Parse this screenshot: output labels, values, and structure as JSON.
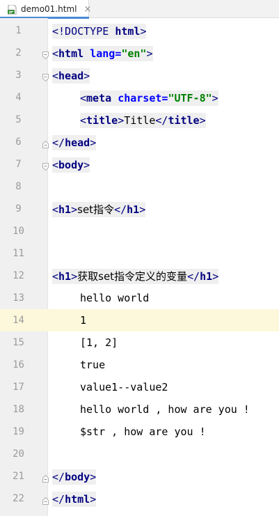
{
  "tab": {
    "filename": "demo01.html",
    "close": "×"
  },
  "current_line": 14,
  "lines": [
    {
      "n": "1",
      "i": 0
    },
    {
      "n": "2",
      "i": 0,
      "fold": true
    },
    {
      "n": "3",
      "i": 0,
      "fold": true
    },
    {
      "n": "4",
      "i": 1
    },
    {
      "n": "5",
      "i": 1
    },
    {
      "n": "6",
      "i": 0,
      "fold": true
    },
    {
      "n": "7",
      "i": 0,
      "fold": true
    },
    {
      "n": "8",
      "i": 0
    },
    {
      "n": "9",
      "i": 0
    },
    {
      "n": "10",
      "i": 0
    },
    {
      "n": "11",
      "i": 0
    },
    {
      "n": "12",
      "i": 0
    },
    {
      "n": "13",
      "i": 1
    },
    {
      "n": "14",
      "i": 1
    },
    {
      "n": "15",
      "i": 1
    },
    {
      "n": "16",
      "i": 1
    },
    {
      "n": "17",
      "i": 1
    },
    {
      "n": "18",
      "i": 1
    },
    {
      "n": "19",
      "i": 1
    },
    {
      "n": "20",
      "i": 0
    },
    {
      "n": "21",
      "i": 0,
      "fold": true
    },
    {
      "n": "22",
      "i": 0,
      "fold": true
    }
  ],
  "code": {
    "l1": {
      "lt": "<",
      "tag": "!DOCTYPE",
      "sp": " ",
      "kw": "html",
      "gt": ">"
    },
    "l2": {
      "lt": "<",
      "tag": "html",
      "sp": " ",
      "attr": "lang",
      "eq": "=",
      "val": "\"en\"",
      "gt": ">"
    },
    "l3": {
      "lt": "<",
      "tag": "head",
      "gt": ">"
    },
    "l4": {
      "lt": "<",
      "tag": "meta",
      "sp": " ",
      "attr": "charset",
      "eq": "=",
      "val": "\"UTF-8\"",
      "gt": ">"
    },
    "l5": {
      "lt": "<",
      "tag": "title",
      "gt": ">",
      "text": "Title",
      "lt2": "</",
      "tag2": "title",
      "gt2": ">"
    },
    "l6": {
      "lt": "</",
      "tag": "head",
      "gt": ">"
    },
    "l7": {
      "lt": "<",
      "tag": "body",
      "gt": ">"
    },
    "l9": {
      "lt": "<",
      "tag": "h1",
      "gt": ">",
      "text": "set指令",
      "lt2": "</",
      "tag2": "h1",
      "gt2": ">"
    },
    "l12": {
      "lt": "<",
      "tag": "h1",
      "gt": ">",
      "text": "获取set指令定义的变量",
      "lt2": "</",
      "tag2": "h1",
      "gt2": ">"
    },
    "l13": "hello world",
    "l14": "1",
    "l15": "[1, 2]",
    "l16": "true",
    "l17": "value1--value2",
    "l18": "hello world , how are you !",
    "l19": "$str , how are you !",
    "l21": {
      "lt": "</",
      "tag": "body",
      "gt": ">"
    },
    "l22": {
      "lt": "</",
      "tag": "html",
      "gt": ">"
    }
  },
  "colors": {
    "tag": "#000080",
    "attr": "#0000ff",
    "string": "#008000",
    "current_line": "#fdf8dc",
    "tab_accent": "#4a8bd6"
  }
}
